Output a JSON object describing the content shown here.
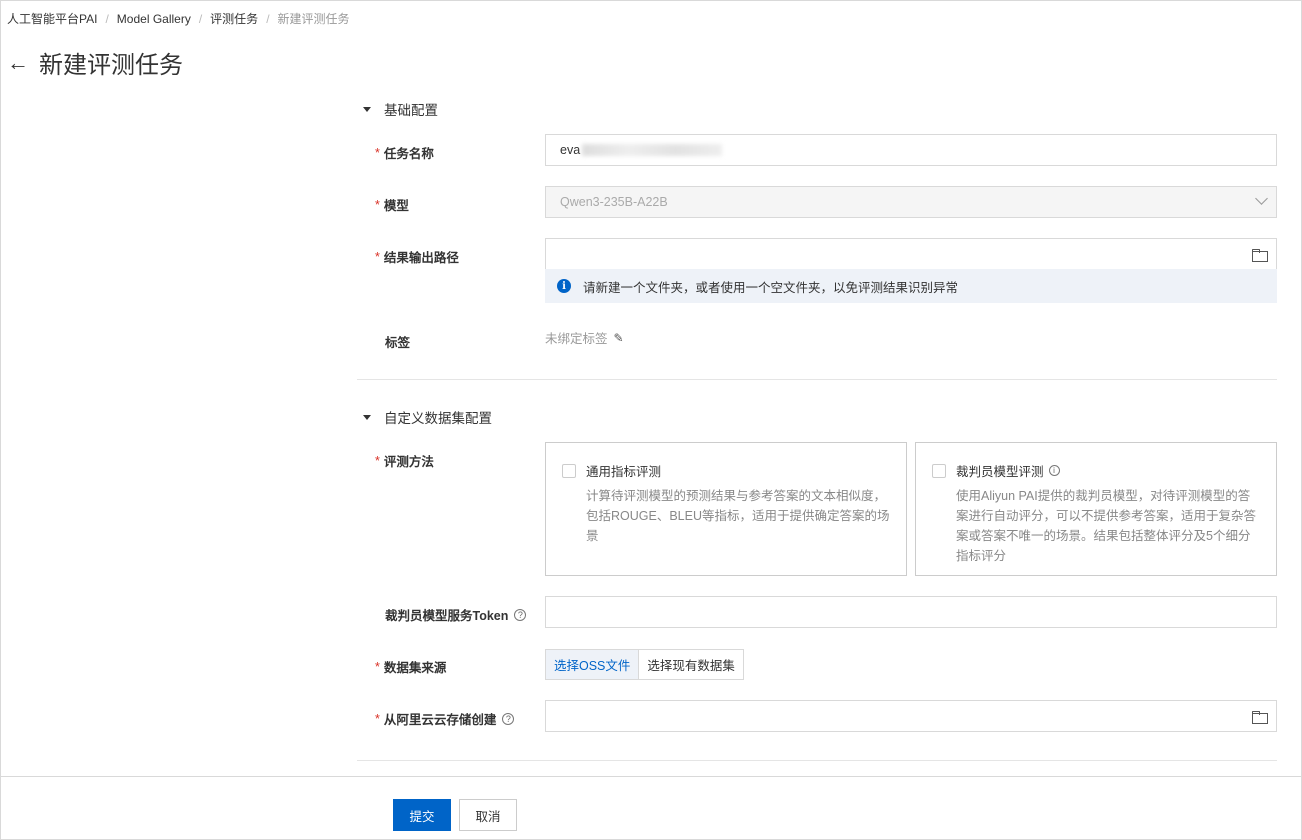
{
  "breadcrumb": {
    "items": [
      "人工智能平台PAI",
      "Model Gallery",
      "评测任务"
    ],
    "current": "新建评测任务"
  },
  "header": {
    "title": "新建评测任务"
  },
  "sections": {
    "basic": "基础配置",
    "dataset": "自定义数据集配置"
  },
  "fields": {
    "task_name": {
      "label": "任务名称",
      "value": "eva"
    },
    "model": {
      "label": "模型",
      "value": "Qwen3-235B-A22B"
    },
    "output_path": {
      "label": "结果输出路径",
      "value": ""
    },
    "output_alert": "请新建一个文件夹，或者使用一个空文件夹，以免评测结果识别异常",
    "tags": {
      "label": "标签",
      "value": "未绑定标签"
    },
    "eval_method": {
      "label": "评测方法"
    },
    "judge_token": {
      "label": "裁判员模型服务Token",
      "value": ""
    },
    "dataset_source": {
      "label": "数据集来源",
      "options": [
        "选择OSS文件",
        "选择现有数据集"
      ]
    },
    "oss_create": {
      "label": "从阿里云云存储创建",
      "value": ""
    }
  },
  "cards": [
    {
      "title": "通用指标评测",
      "desc": "计算待评测模型的预测结果与参考答案的文本相似度，包括ROUGE、BLEU等指标，适用于提供确定答案的场景"
    },
    {
      "title": "裁判员模型评测",
      "desc": "使用Aliyun PAI提供的裁判员模型，对待评测模型的答案进行自动评分，可以不提供参考答案，适用于复杂答案或答案不唯一的场景。结果包括整体评分及5个细分指标评分"
    }
  ],
  "footer": {
    "submit": "提交",
    "cancel": "取消"
  },
  "icons": {
    "back": "arrow-left-icon",
    "folder": "folder-icon",
    "info": "info-icon",
    "edit": "edit-icon",
    "help": "question-circle-icon"
  },
  "colors": {
    "primary": "#0064c8",
    "required": "#d93026",
    "alert_bg": "#eef2f8"
  }
}
